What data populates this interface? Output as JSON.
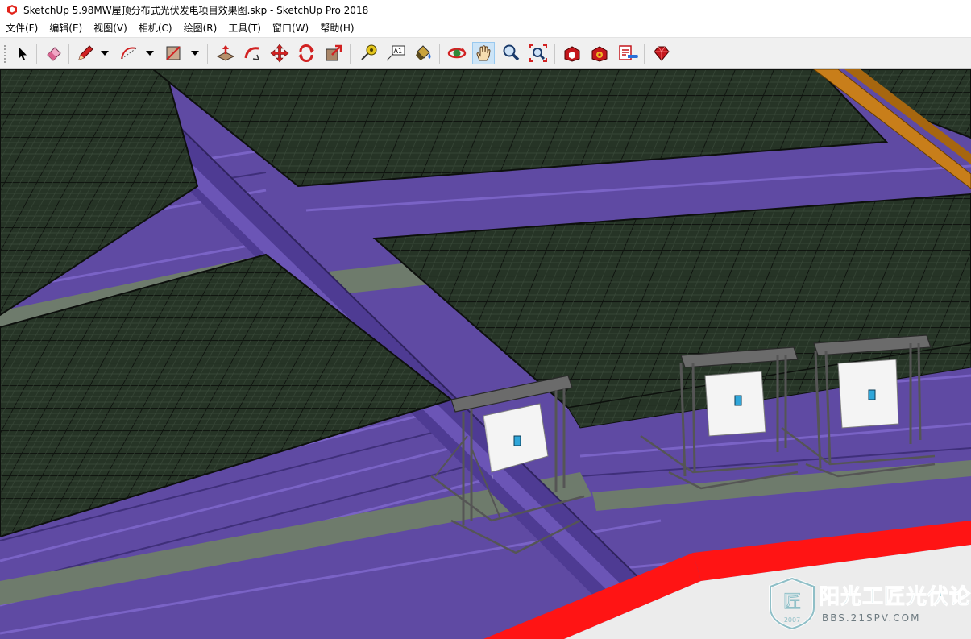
{
  "window": {
    "title": "SketchUp 5.98MW屋顶分布式光伏发电项目效果图.skp - SketchUp Pro 2018",
    "app_icon": "sketchup-logo-icon"
  },
  "menu": [
    {
      "label": "文件(F)"
    },
    {
      "label": "编辑(E)"
    },
    {
      "label": "视图(V)"
    },
    {
      "label": "相机(C)"
    },
    {
      "label": "绘图(R)"
    },
    {
      "label": "工具(T)"
    },
    {
      "label": "窗口(W)"
    },
    {
      "label": "帮助(H)"
    }
  ],
  "toolbar": {
    "text_tool_label": "A1",
    "active_tool": "pan-icon",
    "tools": [
      "select-icon",
      "eraser-icon",
      "pencil-icon",
      "arc-icon",
      "rectangle-icon",
      "push-pull-icon",
      "follow-me-icon",
      "move-icon",
      "rotate-icon",
      "scale-icon",
      "tape-measure-icon",
      "text-icon",
      "paint-bucket-icon",
      "orbit-icon",
      "pan-icon",
      "zoom-icon",
      "zoom-extents-icon",
      "warehouse-icon",
      "extension-warehouse-icon",
      "layout-icon",
      "ruby-icon"
    ]
  },
  "watermark": {
    "title": "阳光工匠光伏论坛",
    "url": "BBS.21SPV.COM",
    "year": "2007",
    "seal_text": "匠"
  },
  "colors": {
    "roof": "#5f4aa3",
    "walkway": "#6f7c6c",
    "panel": "#243224",
    "parapet_edge": "#ff1010",
    "inverter": "#f4f4f4",
    "accent_beam": "#c87e1a"
  }
}
